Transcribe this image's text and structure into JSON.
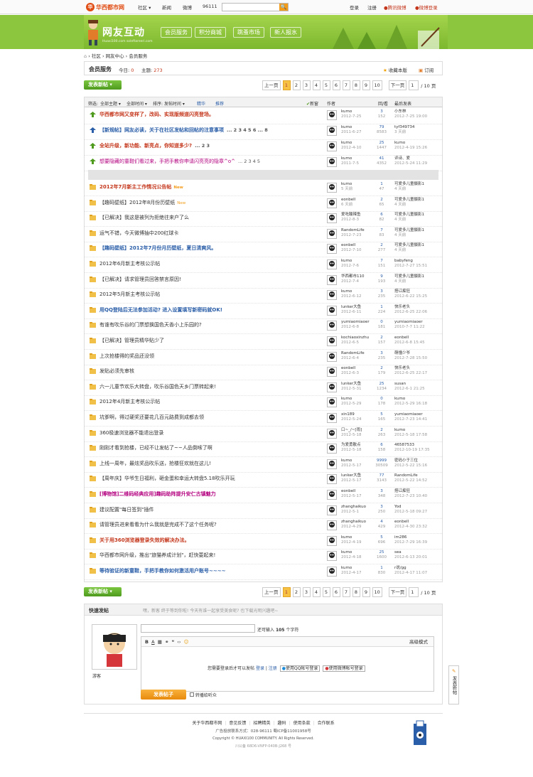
{
  "topbar": {
    "logo_mark": "华",
    "logo_text": "华西都市网",
    "nav": [
      "社区 ▾",
      "新闻",
      "微博",
      "96111"
    ],
    "search_button": "🔍",
    "links": [
      "登录",
      "注册",
      "腾讯微博",
      "新浪微博",
      "微博登录"
    ]
  },
  "banner": {
    "title": "网友互动",
    "subtitle": "Huaxi100.com soleftareeri.com",
    "nav": [
      "会员服务",
      "积分商城",
      "跳蚤市场",
      "新人报水"
    ]
  },
  "breadcrumb": [
    "社区",
    "网友中心",
    "会员服务"
  ],
  "section": {
    "title": "会员服务",
    "today_label": "今日:",
    "today": "0",
    "topics_label": "主题:",
    "topics": "273",
    "favorite": "收藏本版",
    "subscribe": "订阅"
  },
  "actions": {
    "new_post": "发表新帖 ▾"
  },
  "pager": {
    "prev": "上一页",
    "pages": [
      "1",
      "2",
      "3",
      "4",
      "5",
      "6",
      "7",
      "8",
      "9",
      "10"
    ],
    "current": "1",
    "next": "下一页",
    "total": "/ 10 页",
    "input": "1"
  },
  "header": {
    "filter_label": "筛选:",
    "filter_all": "全部主题 ▾",
    "time": "全部时间 ▾",
    "sort": "排序: 发帖时间 ▾",
    "digest": "精华",
    "recommend": "推荐",
    "new_label": "新窗",
    "author": "作者",
    "replies": "回/看",
    "last": "最后发表"
  },
  "sticky": [
    {
      "title": "华西都市网又变样了，改码、实现版频道闪亮登场。",
      "cls": "bold",
      "color": "#c4361b",
      "pages": "",
      "author": "kumo",
      "date": "2012-7-25",
      "r": "3",
      "v": "152",
      "last": "小东林",
      "lastd": "2012-7-25 19:00"
    },
    {
      "title": "【新规帖】网友必读，关于在社区发帖和回帖的注意事项",
      "cls": "bold",
      "color": "#2a5ea8",
      "pages": "... 2 3 4 5 6 ... 8",
      "author": "kumo",
      "date": "2011-6-27",
      "r": "79",
      "v": "8583",
      "last": "tyf349734",
      "lastd": "3 天前"
    },
    {
      "title": "全站升级，新功能、新亮点，你知道多少?",
      "cls": "bold",
      "color": "#c4361b",
      "pages": "... 2 3",
      "author": "kumo",
      "date": "2012-4-10",
      "r": "25",
      "v": "1447",
      "last": "kumo",
      "lastd": "2012-4-19 15:26"
    },
    {
      "title": "想要隐藏的童鞋们看过来，手把手教你申请闪亮亮的隐章^o^",
      "cls": "",
      "color": "#b3007f",
      "pages": "... 2 3 4 5",
      "author": "kumo",
      "date": "2011-7-5",
      "r": "41",
      "v": "4352",
      "last": "评诗、爱",
      "lastd": "2012-5-24 11:29"
    }
  ],
  "threads": [
    {
      "title": "2012年7月新主工作情况公告帖",
      "color": "#c4361b",
      "bold": true,
      "new": "New",
      "author": "kumo",
      "date": "5 天前",
      "r": "1",
      "v": "47",
      "last": "可爱多儿童摄影1",
      "lastd": "4 天前"
    },
    {
      "title": "【趣码壁纸】2012年8月份历壁纸",
      "color": "#333",
      "bold": false,
      "new": "New",
      "author": "eonbell",
      "date": "6 天前",
      "r": "2",
      "v": "65",
      "last": "可爱多儿童摄影1",
      "lastd": "4 天前"
    },
    {
      "title": "【已解决】我这是被列为拒绝往来户了么",
      "color": "#333",
      "bold": false,
      "new": "",
      "author": "爱吃酸辣鱼",
      "date": "2012-8-3",
      "r": "6",
      "v": "82",
      "last": "可爱多儿童摄影1",
      "lastd": "4 天前"
    },
    {
      "title": "运气不错，今天微博抽中200红球卡",
      "color": "#333",
      "bold": false,
      "new": "",
      "author": "RandomLife",
      "date": "2012-7-23",
      "r": "7",
      "v": "83",
      "last": "可爱多儿童摄影1",
      "lastd": "4 天前"
    },
    {
      "title": "【趣码壁纸】2012年7月份月历壁纸，夏日清爽风。",
      "color": "#2a5ea8",
      "bold": true,
      "new": "",
      "author": "eonbell",
      "date": "2012-7-10",
      "r": "2",
      "v": "277",
      "last": "可爱多儿童摄影1",
      "lastd": "4 天前"
    },
    {
      "title": "2012年6月新主考核公示帖",
      "color": "#333",
      "bold": false,
      "new": "",
      "author": "kumo",
      "date": "2012-7-6",
      "r": "7",
      "v": "151",
      "last": "babyfeng",
      "lastd": "2012-7-27 15:51"
    },
    {
      "title": "【已解决】请求管理员回答禁言原因!",
      "color": "#333",
      "bold": false,
      "new": "",
      "author": "华西都市110",
      "date": "2012-7-4",
      "r": "9",
      "v": "193",
      "last": "可爱多儿童摄影1",
      "lastd": "4 天前"
    },
    {
      "title": "2012年5月新主考核公示帖",
      "color": "#333",
      "bold": false,
      "new": "",
      "author": "kumo",
      "date": "2012-6-12",
      "r": "3",
      "v": "235",
      "last": "搭讧痴狂",
      "lastd": "2012-6-22 15:25"
    },
    {
      "title": "用QQ登陆后无法参加活动? 进入设置填写新密码就OK!",
      "color": "#2a5ea8",
      "bold": true,
      "new": "",
      "author": "lunker大鱼",
      "date": "2012-6-11",
      "r": "1",
      "v": "224",
      "last": "快乐老头",
      "lastd": "2012-6-25 22:06"
    },
    {
      "title": "有谁有吹乐谷的门票想换国色天香小上乐园的?",
      "color": "#333",
      "bold": false,
      "new": "",
      "author": "yumiaomiaoer",
      "date": "2012-6-8",
      "r": "0",
      "v": "181",
      "last": "yumiaomiaoer",
      "lastd": "2010-7-7 11:22"
    },
    {
      "title": "【已解决】管理员精华贴少了",
      "color": "#333",
      "bold": false,
      "new": "",
      "author": "kochiaoxinzhu",
      "date": "2012-6-5",
      "r": "2",
      "v": "157",
      "last": "eonbell",
      "lastd": "2012-6-8 15:45"
    },
    {
      "title": "上次抢楼得的奖品还没领",
      "color": "#333",
      "bold": false,
      "new": "",
      "author": "RandomLife",
      "date": "2012-6-4",
      "r": "3",
      "v": "235",
      "last": "萌懂少爷",
      "lastd": "2012-7-28 15:50"
    },
    {
      "title": "发贴必须先审核",
      "color": "#333",
      "bold": false,
      "new": "",
      "author": "eonbell",
      "date": "2012-6-3",
      "r": "2",
      "v": "179",
      "last": "快乐老头",
      "lastd": "2012-6-25 22:17"
    },
    {
      "title": "六一儿童节欢乐大转盘，吹乐谷国色天乡门票转起来!",
      "color": "#333",
      "bold": false,
      "new": "",
      "author": "lunker大鱼",
      "date": "2012-5-31",
      "r": "25",
      "v": "1234",
      "last": "susan",
      "lastd": "2012-6-1 21:25"
    },
    {
      "title": "2012年4月新主考核公示帖",
      "color": "#333",
      "bold": false,
      "new": "",
      "author": "kumo",
      "date": "2012-5-29",
      "r": "0",
      "v": "178",
      "last": "kumo",
      "lastd": "2012-5-29 16:18"
    },
    {
      "title": "坑爹啊，得过硬奖还要花几百元路费到成都去领",
      "color": "#333",
      "bold": false,
      "new": "",
      "author": "xin189",
      "date": "2012-5-24",
      "r": "5",
      "v": "165",
      "last": "yumiaomiaoer",
      "lastd": "2012-7-23 14:41"
    },
    {
      "title": "360极速浏览器不能退出登录",
      "color": "#333",
      "bold": false,
      "new": "",
      "author": "口~_/~[雨]",
      "date": "2012-5-18",
      "r": "2",
      "v": "263",
      "last": "kumo",
      "lastd": "2012-5-18 17:58"
    },
    {
      "title": "刚刚才看到抢楼，已经不让发帖了~~人品倒嗦了啊",
      "color": "#333",
      "bold": false,
      "new": "",
      "author": "为爱勇散点",
      "date": "2012-5-18",
      "r": "6",
      "v": "158",
      "last": "46587533",
      "lastd": "2012-10-19 17:35"
    },
    {
      "title": "上线一周年，最炫奖品吹乐送，抢楼狂欢就在这儿!",
      "color": "#333",
      "bold": false,
      "new": "",
      "author": "kumo",
      "date": "2012-5-17",
      "r": "9999",
      "v": "30509",
      "last": "密码小于三位",
      "lastd": "2012-5-22 15:16"
    },
    {
      "title": "【周年庆】华爷生日福利，砸金蛋和幸运大转盘5.18吹乐开玩",
      "color": "#333",
      "bold": false,
      "new": "",
      "author": "lunker大鱼",
      "date": "2012-5-17",
      "r": "77",
      "v": "3143",
      "last": "RandomLife",
      "lastd": "2012-5-22 14:52"
    },
    {
      "title": "[博物馆]二维码经典应用]趣码助阵提升安仁古镇魅力",
      "color": "#b3007f",
      "bold": true,
      "new": "",
      "author": "eonbell",
      "date": "2012-5-17",
      "r": "3",
      "v": "348",
      "last": "搭讧痴狂",
      "lastd": "2012-7-23 10:40"
    },
    {
      "title": "建议配置\"每日签到\"插件",
      "color": "#333",
      "bold": false,
      "new": "",
      "author": "zhanghaikuo",
      "date": "2012-5-1",
      "r": "3",
      "v": "250",
      "last": "Yod",
      "lastd": "2012-5-18 09:27"
    },
    {
      "title": "请管理员进来看看为什么我就是完成不了这个任务呢?",
      "color": "#333",
      "bold": false,
      "new": "",
      "author": "zhanghaikuo",
      "date": "2012-4-29",
      "r": "4",
      "v": "429",
      "last": "eonbell",
      "lastd": "2012-4-30 23:32"
    },
    {
      "title": "关于用360浏览器登录失效的解决办法。",
      "color": "#c4361b",
      "bold": true,
      "new": "",
      "author": "kumo",
      "date": "2012-4-19",
      "r": "5",
      "v": "696",
      "last": "im286",
      "lastd": "2012-7-29 16:39"
    },
    {
      "title": "华西都市网升级，推出\"旅猫养成计划\"，赶快耍起来!",
      "color": "#333",
      "bold": false,
      "new": "",
      "author": "kumo",
      "date": "2012-4-18",
      "r": "25",
      "v": "1600",
      "last": "sea",
      "lastd": "2012-6-13 20:01"
    },
    {
      "title": "等待验证的新童鞋，手把手教你如何激活用户账号~~~~",
      "color": "#2a5ea8",
      "bold": true,
      "new": "",
      "author": "kumo",
      "date": "2012-4-17",
      "r": "1",
      "v": "830",
      "last": "r说/gg",
      "lastd": "2012-4-17 11:07"
    }
  ],
  "quickpost": {
    "title": "快速发帖",
    "hint": "嘿，新客 终于等到你啦! 今天有谁一起享受美食呢? 也下载光明兴趣吧~",
    "limit_label": "还可输入",
    "limit": "105",
    "limit_unit": "个字符",
    "advanced": "高级模式",
    "login_msg": "您需要登录后才可以发帖",
    "login": "登录",
    "register": "注册",
    "qq_btn": "使用QQ帐号登录",
    "weibo_btn": "使用微博帐号登录",
    "guest": "游客",
    "submit": "发表帖子",
    "sync": "转播给听众"
  },
  "footer": {
    "links": [
      "关于华西都市网",
      "意见反馈",
      "招聘精英",
      "趣码",
      "使用条款",
      "合作联系"
    ],
    "ad": "广告投放联系方式：028-96111  蜀ICP备11001958号",
    "copy": "Copyright © HUAXI100 COMMUNITY. All Rights Reserved.",
    "id": "川公备 68D6-VNFP-040B-J268 号"
  },
  "sidetab": "发表新帖"
}
